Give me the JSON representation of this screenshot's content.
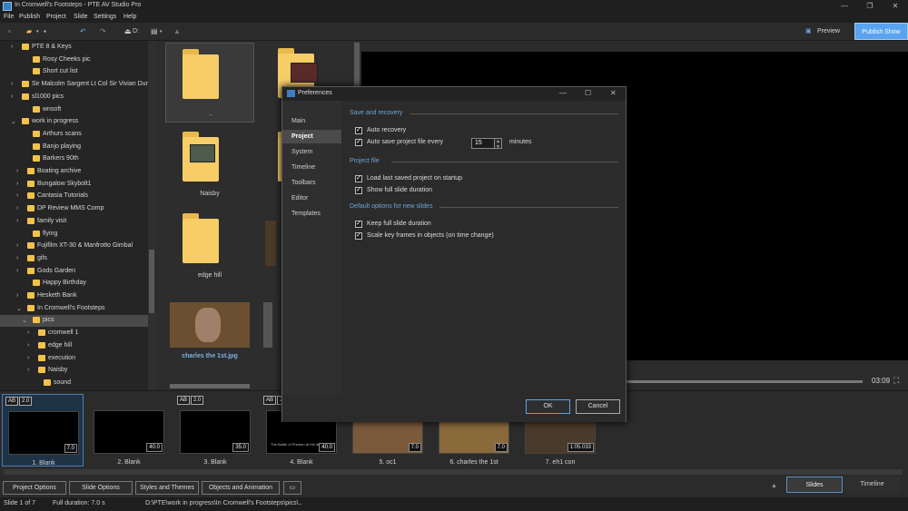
{
  "window": {
    "title": "In Cromwell's Footsteps - PTE AV Studio Pro"
  },
  "menu": [
    "File",
    "Publish",
    "Project",
    "Slide",
    "Settings",
    "Help"
  ],
  "toolbar": {
    "drive_label": "D:",
    "preview_label": "Preview",
    "publish_label": "Publish Show"
  },
  "tree": [
    {
      "label": "PTE 8 & Keys",
      "arrow": "›"
    },
    {
      "label": "Rosy Cheeks pic",
      "arrow": ""
    },
    {
      "label": "Short cut list",
      "arrow": ""
    },
    {
      "label": "Sir Malcolm Sargent Lt Col Sir Vivian Dun",
      "arrow": "›"
    },
    {
      "label": "sl1000 pics",
      "arrow": "›"
    },
    {
      "label": "wnsoft",
      "arrow": ""
    },
    {
      "label": "work in progress",
      "arrow": "⌄"
    },
    {
      "label": "Arthurs scans",
      "arrow": ""
    },
    {
      "label": "Banjo playing",
      "arrow": ""
    },
    {
      "label": "Barkers 90th",
      "arrow": ""
    },
    {
      "label": "Boating archive",
      "arrow": "›"
    },
    {
      "label": "Bungalow Skybolt1",
      "arrow": "›"
    },
    {
      "label": "Cantasia Tutorials",
      "arrow": "›"
    },
    {
      "label": "DP Review MMS Comp",
      "arrow": "›"
    },
    {
      "label": "family visit",
      "arrow": "›"
    },
    {
      "label": "flying",
      "arrow": ""
    },
    {
      "label": "Fujifilm XT-30 & Manfrotto Gimbal",
      "arrow": "›"
    },
    {
      "label": "gifs",
      "arrow": "›"
    },
    {
      "label": "Gods Garden",
      "arrow": "›"
    },
    {
      "label": "Happy Birthday",
      "arrow": ""
    },
    {
      "label": "Hesketh Bank",
      "arrow": "›"
    },
    {
      "label": "In Cromwell's Footsteps",
      "arrow": "⌄"
    },
    {
      "label": "pics",
      "arrow": "⌄"
    },
    {
      "label": "cromwell 1",
      "arrow": "›"
    },
    {
      "label": "edge hill",
      "arrow": "›"
    },
    {
      "label": "execution",
      "arrow": "›"
    },
    {
      "label": "Naisby",
      "arrow": "›"
    },
    {
      "label": "sound",
      "arrow": ""
    }
  ],
  "files": {
    "up_label": "..",
    "naisby": "Naisby",
    "edgehill": "edge hill",
    "charles": "charles the 1st.jpg"
  },
  "preview": {
    "time": "03:09"
  },
  "dialog": {
    "title": "Preferences",
    "nav": [
      "Main",
      "Project",
      "System",
      "Timeline",
      "Toolbars",
      "Editor",
      "Templates"
    ],
    "section1": "Save and recovery",
    "auto_recovery": "Auto recovery",
    "auto_save": "Auto save project file every",
    "auto_save_value": "15",
    "minutes": "minutes",
    "section2": "Project file",
    "load_last": "Load last saved project on startup",
    "show_full": "Show full slide duration",
    "section3": "Default options for new slides",
    "keep_full": "Keep full slide duration",
    "scale_key": "Scale key frames in objects (on time change)",
    "ok": "OK",
    "cancel": "Cancel"
  },
  "slides": [
    {
      "badge1": "AB",
      "badge2": "2.0",
      "dur": "7.0",
      "name": "1. Blank"
    },
    {
      "badge1": "",
      "badge2": "",
      "dur": "40.0",
      "name": "2. Blank"
    },
    {
      "badge1": "AB",
      "badge2": "2.0",
      "dur": "35.0",
      "name": "3. Blank"
    },
    {
      "badge1": "AB",
      "badge2": "2.",
      "dur": "40.0",
      "name": "4. Blank"
    },
    {
      "badge1": "",
      "badge2": "",
      "dur": "7.0",
      "name": "5. oc1"
    },
    {
      "badge1": "",
      "badge2": "",
      "dur": "7.0",
      "name": "6. charles the 1st"
    },
    {
      "badge1": "",
      "badge2": "",
      "dur": "1:05.033",
      "name": "7. eh1 con"
    }
  ],
  "slide4_caption": "The Battle of Preston at Hill devasted",
  "bottom": {
    "project_options": "Project Options",
    "slide_options": "Slide Options",
    "styles": "Styles and Themes",
    "objects": "Objects and Animation",
    "slides_tab": "Slides",
    "timeline_tab": "Timeline"
  },
  "status": {
    "slide": "Slide 1 of 7",
    "duration": "Full duration: 7.0 s",
    "path": "D:\\PTE\\work in progress\\In Cromwell's Footsteps\\pics\\.."
  }
}
